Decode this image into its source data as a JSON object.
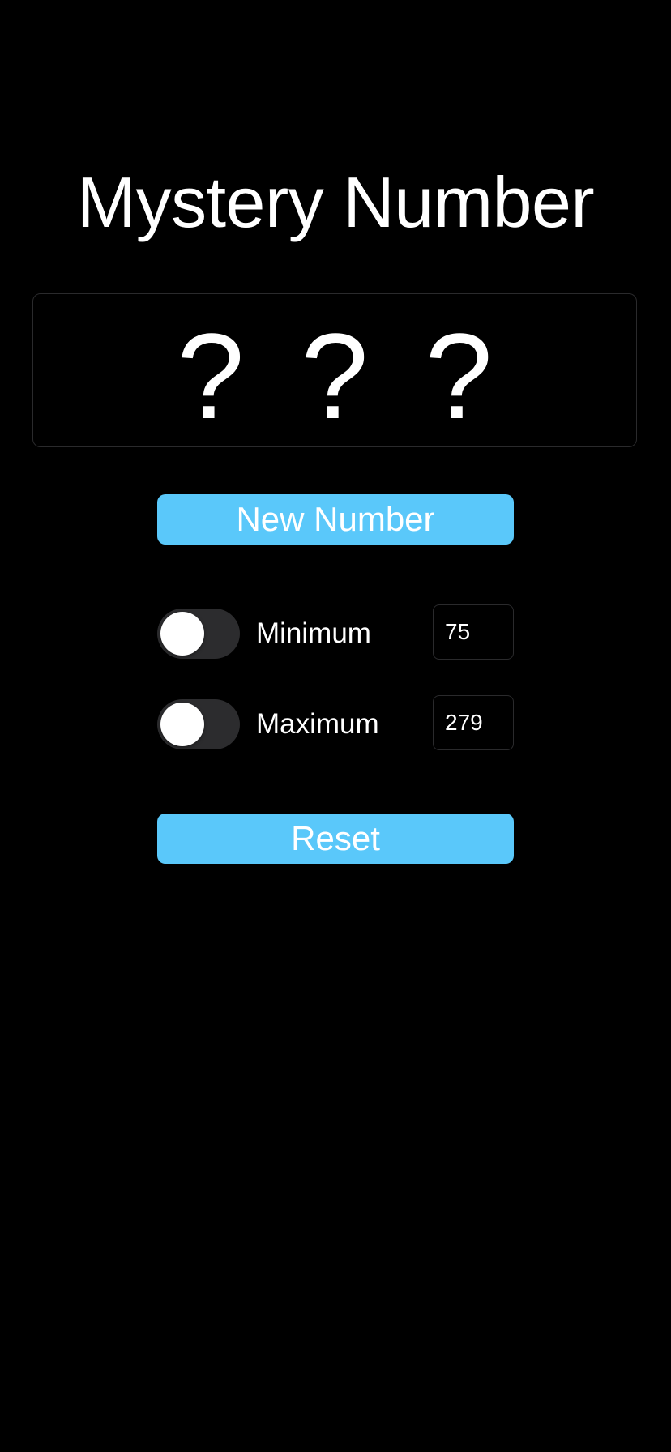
{
  "app": {
    "title": "Mystery Number"
  },
  "display": {
    "value": "? ? ?"
  },
  "buttons": {
    "new_number_label": "New Number",
    "reset_label": "Reset"
  },
  "limits": {
    "minimum": {
      "label": "Minimum",
      "value": "75",
      "toggle_on": false
    },
    "maximum": {
      "label": "Maximum",
      "value": "279",
      "toggle_on": false
    }
  },
  "colors": {
    "background": "#000000",
    "accent": "#5ac8fa",
    "text": "#ffffff",
    "toggle_track_off": "#2c2c2e",
    "border": "#2a2a2c"
  }
}
